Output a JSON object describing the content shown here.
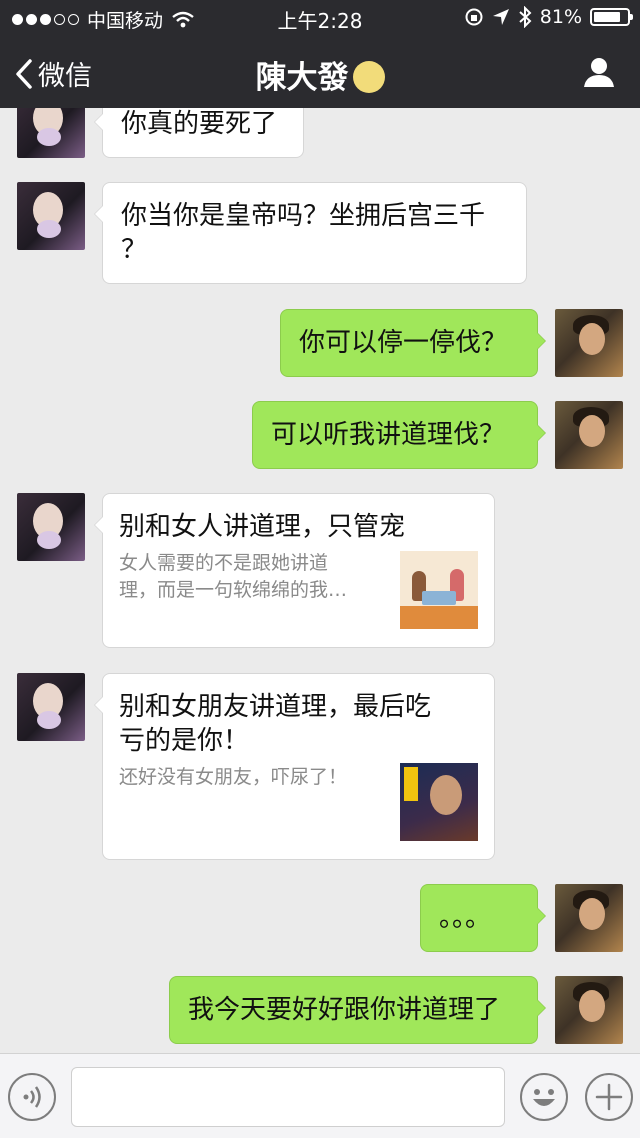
{
  "status_bar": {
    "carrier": "中国移动",
    "time": "上午2:28",
    "battery": "81%",
    "battery_level": 0.81
  },
  "nav": {
    "back_label": "微信",
    "title": "陳大發"
  },
  "messages": [
    {
      "side": "in",
      "type": "text",
      "text": "你真的要死了"
    },
    {
      "side": "in",
      "type": "text",
      "lines": [
        "你当你是皇帝吗？坐拥后宫三千",
        "？"
      ]
    },
    {
      "side": "out",
      "type": "text",
      "text": "你可以停一停伐？"
    },
    {
      "side": "out",
      "type": "text",
      "text": "可以听我讲道理伐？"
    },
    {
      "side": "in",
      "type": "card",
      "title": "别和女人讲道理，只管宠",
      "desc": [
        "女人需要的不是跟她讲道",
        "理，而是一句软绵绵的我…"
      ]
    },
    {
      "side": "in",
      "type": "card",
      "title_lines": [
        "别和女朋友讲道理，最后吃",
        "亏的是你！"
      ],
      "desc": [
        "还好没有女朋友，吓尿了！"
      ]
    },
    {
      "side": "out",
      "type": "text",
      "text": "。。。"
    },
    {
      "side": "out",
      "type": "text",
      "text": "我今天要好好跟你讲道理了"
    }
  ],
  "input": {
    "placeholder": ""
  },
  "colors": {
    "nav_bg": "#2b2b2f",
    "chat_bg": "#ebebeb",
    "outgoing_bubble": "#a0e75a",
    "incoming_bubble": "#ffffff"
  },
  "icons": [
    "signal-dots-icon",
    "wifi-icon",
    "lock-rotation-icon",
    "location-arrow-icon",
    "bluetooth-icon",
    "battery-icon",
    "back-chevron-icon",
    "moon-emoji-icon",
    "person-icon",
    "voice-icon",
    "emoji-icon",
    "plus-icon"
  ]
}
